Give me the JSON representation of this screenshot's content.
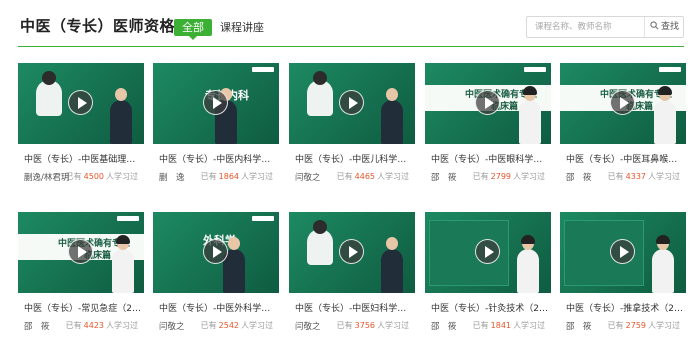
{
  "header": {
    "title": "中医（专长）医师资格",
    "tabs": [
      {
        "label": "全部",
        "active": true
      },
      {
        "label": "课程讲座",
        "active": false
      }
    ],
    "search": {
      "placeholder": "课程名称、教师名称",
      "button_label": "查找"
    }
  },
  "colors": {
    "accent": "#3cb034",
    "count": "#e8552c",
    "thumb": "#156e50"
  },
  "learners_prefix": "已有",
  "learners_suffix": "人学习过",
  "courses": [
    {
      "title": "中医（专长）-中医基础理论（",
      "teacher": "蒯逸/林君玥",
      "count": "4500",
      "thumb": "cartoon-teacher"
    },
    {
      "title": "中医（专长）-中医内科学（20",
      "teacher": "蒯　逸",
      "count": "1864",
      "thumb": "neike"
    },
    {
      "title": "中医（专长）-中医儿科学（20",
      "teacher": "闫敬之",
      "count": "4465",
      "thumb": "cartoon-teacher"
    },
    {
      "title": "中医（专长）-中医眼科学（20",
      "teacher": "邵　筱",
      "count": "2799",
      "thumb": "banner-female"
    },
    {
      "title": "中医（专长）-中医耳鼻喉科学（",
      "teacher": "邵　筱",
      "count": "4337",
      "thumb": "banner-female"
    },
    {
      "title": "中医（专长）-常见急症（201",
      "teacher": "邵　筱",
      "count": "4423",
      "thumb": "banner-female"
    },
    {
      "title": "中医（专长）-中医外科学（20",
      "teacher": "闫敬之",
      "count": "2542",
      "thumb": "waike"
    },
    {
      "title": "中医（专长）-中医妇科学（20",
      "teacher": "闫敬之",
      "count": "3756",
      "thumb": "cartoon-teacher"
    },
    {
      "title": "中医（专长）-针灸技术（201",
      "teacher": "邵　筱",
      "count": "1841",
      "thumb": "board-female"
    },
    {
      "title": "中医（专长）-推拿技术（201",
      "teacher": "邵　筱",
      "count": "2759",
      "thumb": "board-female"
    }
  ],
  "thumb_text": {
    "neike": "专长内科",
    "waike": "外科学",
    "banner": "中医医术确有专长",
    "banner_sub": "临床篇"
  }
}
